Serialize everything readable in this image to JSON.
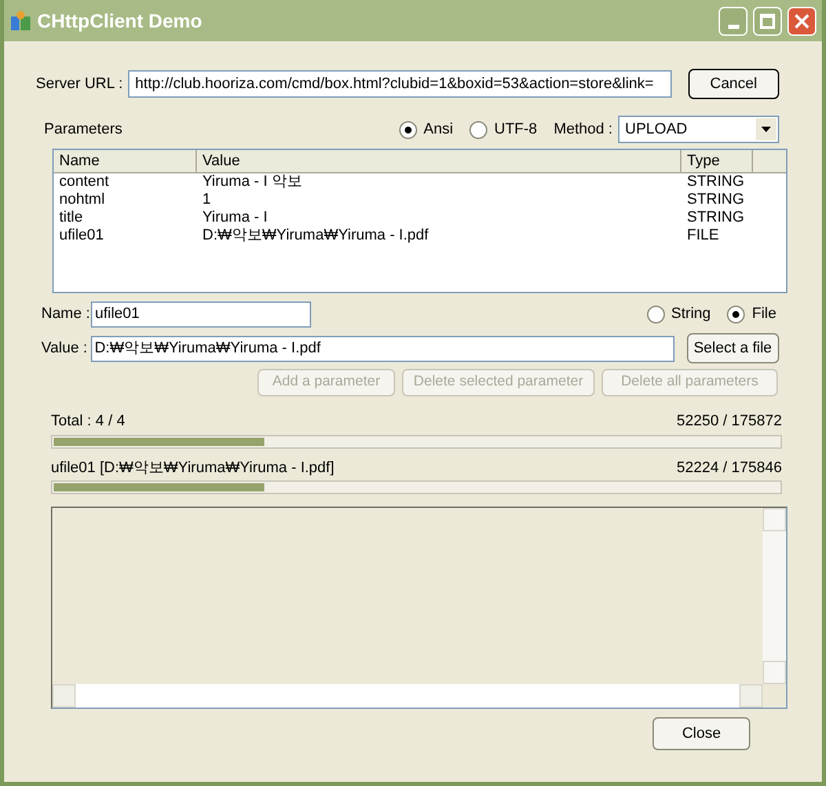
{
  "window": {
    "title": "CHttpClient Demo"
  },
  "server_url": {
    "label": "Server URL :",
    "value": "http://club.hooriza.com/cmd/box.html?clubid=1&boxid=53&action=store&link="
  },
  "cancel_button": {
    "label": "Cancel",
    "disabled": false
  },
  "parameters_label": "Parameters",
  "encoding": [
    {
      "label": "Ansi",
      "selected": true
    },
    {
      "label": "UTF-8",
      "selected": false
    }
  ],
  "method": {
    "label": "Method :",
    "value": "UPLOAD"
  },
  "table": {
    "columns": [
      "Name",
      "Value",
      "Type"
    ],
    "rows": [
      {
        "cells": [
          "content",
          "Yiruma - I 악보",
          "STRING"
        ]
      },
      {
        "cells": [
          "nohtml",
          "1",
          "STRING"
        ]
      },
      {
        "cells": [
          "title",
          "Yiruma - I",
          "STRING"
        ]
      },
      {
        "cells": [
          "ufile01",
          "D:₩악보₩Yiruma₩Yiruma - I.pdf",
          "FILE"
        ]
      }
    ]
  },
  "name_field": {
    "label": "Name :",
    "value": "ufile01"
  },
  "value_field": {
    "label": "Value :",
    "value": "D:₩악보₩Yiruma₩Yiruma - I.pdf"
  },
  "param_type": [
    {
      "label": "String",
      "selected": false
    },
    {
      "label": "File",
      "selected": true
    }
  ],
  "select_file_button": {
    "label": "Select a file",
    "disabled": false
  },
  "actions": [
    {
      "label": "Add a parameter",
      "disabled": true
    },
    {
      "label": "Delete selected parameter",
      "disabled": true
    },
    {
      "label": "Delete all parameters",
      "disabled": true
    }
  ],
  "progress": [
    {
      "label": "Total : 4 / 4",
      "reading": "52250 / 175872",
      "level": 0.29
    },
    {
      "label": "ufile01 [D:₩악보₩Yiruma₩Yiruma - I.pdf]",
      "reading": "52224 / 175846",
      "level": 0.29
    }
  ],
  "close_button": {
    "label": "Close",
    "disabled": false
  }
}
